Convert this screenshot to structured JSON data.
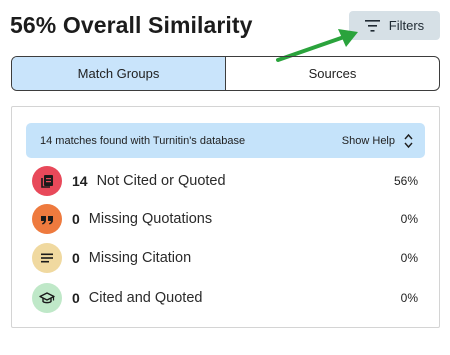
{
  "header": {
    "title": "56% Overall Similarity",
    "filters_label": "Filters"
  },
  "tabs": [
    {
      "label": "Match Groups",
      "active": true
    },
    {
      "label": "Sources",
      "active": false
    }
  ],
  "info_bar": {
    "text": "14 matches found with Turnitin's database",
    "help_label": "Show Help"
  },
  "groups": [
    {
      "count": "14",
      "label": "Not Cited or Quoted",
      "percent": "56%",
      "icon": "copy-icon",
      "color": "#e8495a"
    },
    {
      "count": "0",
      "label": "Missing Quotations",
      "percent": "0%",
      "icon": "quote-icon",
      "color": "#ee7a3e"
    },
    {
      "count": "0",
      "label": "Missing Citation",
      "percent": "0%",
      "icon": "lines-icon",
      "color": "#f0d9a0"
    },
    {
      "count": "0",
      "label": "Cited and Quoted",
      "percent": "0%",
      "icon": "graduation-cap-icon",
      "color": "#bfe8c8"
    }
  ],
  "colors": {
    "accent_blue": "#c5e3fa",
    "filter_button": "#d6e0e6",
    "annotation_arrow": "#2aa33c"
  }
}
